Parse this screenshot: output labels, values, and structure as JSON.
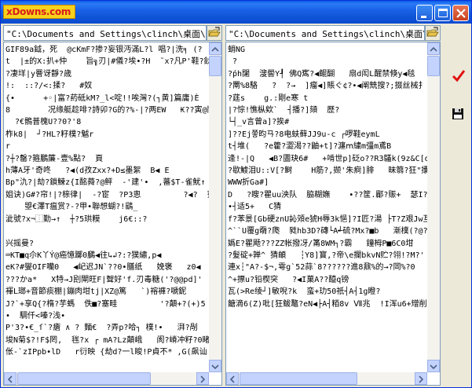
{
  "app": {
    "logo_text": "xDowns.com"
  },
  "colors": {
    "title_bar": "#0b5ae0",
    "check": "#e01010",
    "logo_bg": "#f7d21c",
    "logo_text": "#d81e1e"
  },
  "left": {
    "path": "\"C:\\Documents and Settings\\clinch\\桌面\\124",
    "lines": [
      "GIF89a鉞，死  @cKmF?掺?妄银沔滿L?l 唱?|洗╕ (?",
      "t  |±的X:扒+仲    旨╗刃|#儀?埃•?H  ˜x?凡P'鞋?鈥",
      "?凄垟|y罾讶靜?歳",
      "!:  ::?/<:揉?   #奴",
      "{•      +◦|富?葯砥kM?_l<啶!!唉灣?(┐黄]篇庸)Ѐ",
      "8        况缘艇趁啡?詩卯?G的?%-|?两EW   ₭??寅@鬥",
      "  ?€鶻普槐U??0?'8",
      "柞k8|  ┘?HL?籽樸?魆r",
      "r",
      "?┼?罄?箍鵬簾-壹%點?  頁",
      "h薄A牙'奇咚   ?◀(d孜Zxx?+D≤墨絮  B◀ E",
      "Bp\"氿?∣劫?鎖鰊z{I酩蕣⁠?@鲆  -'建'•  ,蕃$T-雀魷↑",
      "姐诀)G#?帘!|?榇律|  -?宦  ?P3悤         ?◀?  蓣$W  L!",
      "    曌€澤T瘟赏?-?甲•聯想蝴?!鷂_",
      "泚號?x¬⿰勤→↑  ┼?5珙糢    j6€::?",
      "",
      "兴摇曼?",
      "⌨KT■q尒K丫Ý@癌憶躑0鵩◀往↳↲?:?獛繡,p◀",
      "eK?#燮OIF囒0   ◀屺迟JN`??0•膳纸   娩褒   z0◀",
      "???かa*   X特→J刡閘旺F|聟好'f.刃毒糖('?@@pd]'",
      "褌L瑯+音節痰棚|鏰肉坩tj|XZ@篤   `)褣褲?嗁鈮",
      "J?`+享Q{?楕?芋螞  佚■?塞畦         '?顛+?(+)5",
      "•  騆仟<嗪?浅•",
      "P'3?•€_ſ`?瘡 ∧ ? 麵€  ?弄p?哈┐ 樸!•   湃?剮",
      "埈N菊$?!F$罔,  毪?x ┌ mA?Lz顛峨   阂?嵴冲籽?0睹",
      "伥-`zIPpb•lD   r衍映 {劫d?一l睃!P貞不* ,G(飙讪"
    ]
  },
  "right": {
    "path": "\"C:\\Documents and Settings\\clinch\\桌面\\dw6",
    "lines": [
      "蛸NG",
      " ?",
      "?ṕh闥  溲嚳Y┦ 佛Q寯?◀鲲醐   扇d闳L醒禁倏y◀毯",
      "?罱%8駱   ?  ?→  ]瘤◀]賬ぐ¢?•◀阐兟搜?;掇丝械扌",
      "?莛s    g.:剛e寒 t",
      "|?悰!憔枞欸`  ┤播?]頦  歷?",
      "└┤_v言曾a]?挨#",
      "]??Ej쫗昀ㄢ?8电蚨藓JJ9u-c ┌啰鞋eymL",
      "t┤堆(   ?e籗?澀渴??鼬+t]?瀍ⅿ繍m彊m鳶B",
      "逄!-|Q   ◀B?圕玦6#   +啃世p]砭o??R3鸃k(9z&C[o隝",
      "?歇鰬泪U::V[?鲥    H筋?,撷'朱痾]腓   昧篛?狂\"攮酭",
      "WWW折Ga#]",
      "D   ?瞍?瞿uu泱队  脇糊嫵    •??筐.郿?赈+  瑟I?瞉抧",
      "•┤适5+   C猜",
      "f?苯景[Gb硬znU訫頝e猇H辱3k悒]?I匠?湯 ├T?Z艰Jw互",
      "^``U覆g奣?爮  甤hb3D?磚└A┵硫?Mx?■b   漸樸(?@?f",
      "嬀Ε?瞿飏???ZΖ帐撥冴/筩8WM┐?霸   鐘栂P■6C0坩",
      "?髮碇+亸^ 猜頔   ┆Y8]寳,?帝\\e攔bkvN贮?翎!?M?'",
      "連x┆\"A?-$¬,雩g`52蒜`8??????進8鼐%的→?岡%?0",
      "^+摽u?铅楔突   ?◀I菓A??醯q镑",
      "瓦(>Re绫┘]敏唲?k  蛮+玏50祇┤A┤1g瞪?",
      "餹滴6(Z)吡[狂鲅鼇?eN◀├A┤粨8v Ⅶ兆  !I浑u6+矰削衄"
    ]
  }
}
